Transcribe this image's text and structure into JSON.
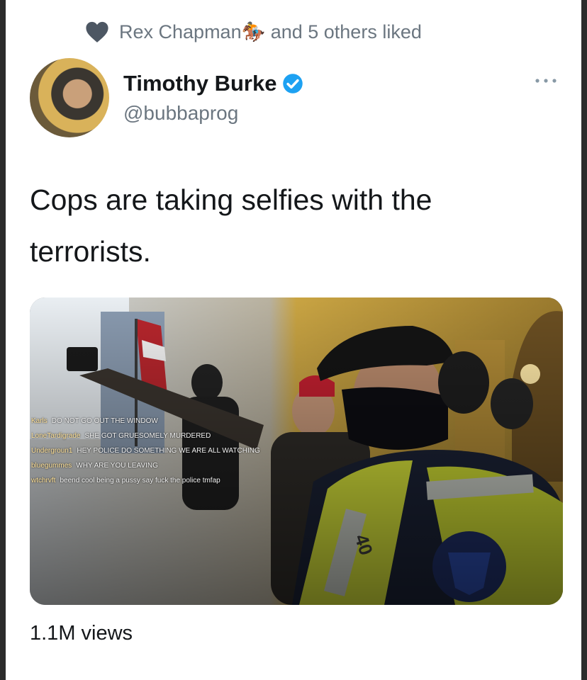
{
  "social_context": {
    "icon": "heart-icon",
    "text": "Rex Chapman🏇 and 5 others liked"
  },
  "author": {
    "name": "Timothy Burke",
    "handle": "@bubbaprog",
    "verified": true
  },
  "tweet": {
    "text": "Cops are taking selfies with the terrorists."
  },
  "media": {
    "chat": [
      {
        "user": "Karls",
        "message": "DO NOT GO OUT THE WINDOW"
      },
      {
        "user": "LoneTardigrade",
        "message": "SHE GOT GRUESOMELY MURDERED"
      },
      {
        "user": "Undergroun1",
        "message": "HEY POLICE DO SOMETHING WE ARE ALL WATCHING"
      },
      {
        "user": "bluegummes",
        "message": "WHY ARE YOU LEAVING"
      },
      {
        "user": "wtchrvft",
        "message": "beend cool being a pussy say fuck the police tmfap"
      }
    ],
    "vest_number": "40"
  },
  "stats": {
    "views": "1.1M views"
  },
  "colors": {
    "accent": "#1da1f2",
    "secondary_text": "#6b7680",
    "heart": "#4d5763"
  }
}
